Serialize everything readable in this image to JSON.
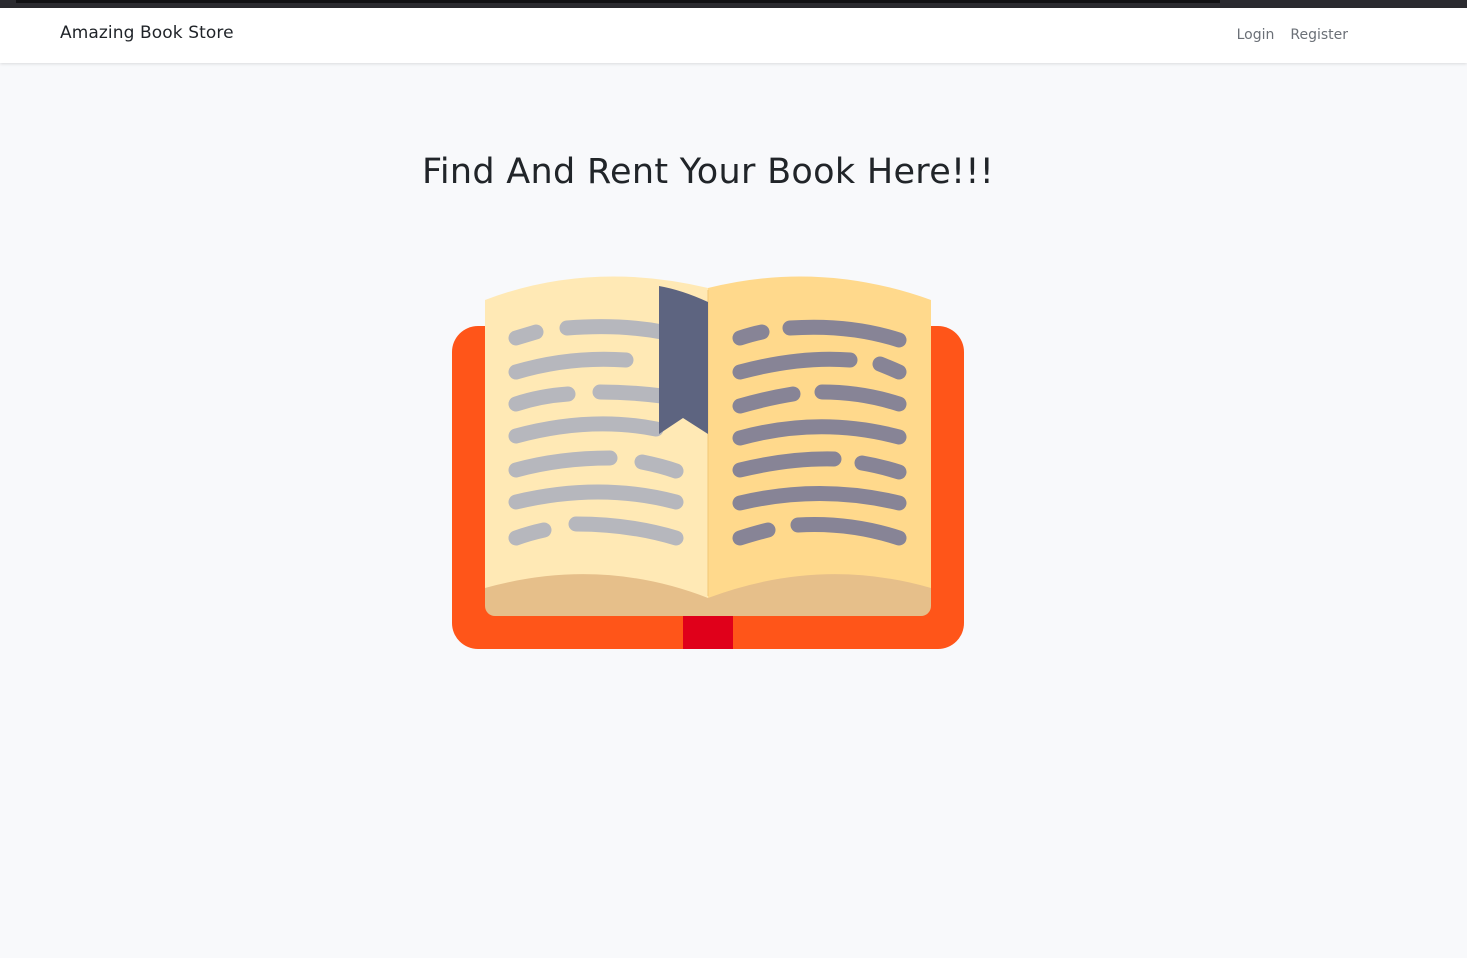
{
  "navbar": {
    "brand": "Amazing Book Store",
    "links": [
      {
        "label": "Login"
      },
      {
        "label": "Register"
      }
    ]
  },
  "hero": {
    "title": "Find And Rent Your Book Here!!!"
  },
  "illustration": {
    "icon": "open-book-icon",
    "colors": {
      "cover": "#ff5519",
      "spine_tab": "#e0001a",
      "page_base": "#e6bf8a",
      "left_page": "#ffe9b5",
      "right_page": "#ffd98c",
      "bookmark": "#5d6480",
      "left_lines": "#b6b7bd",
      "right_lines": "#878496"
    }
  }
}
